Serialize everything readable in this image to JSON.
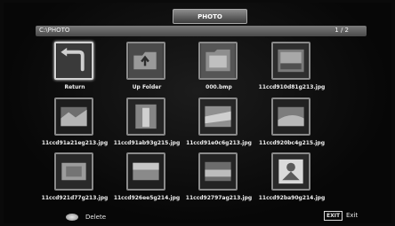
{
  "header": {
    "title": "PHOTO"
  },
  "path_bar": {
    "path": "C:\\PHOTO",
    "page": "1 / 2"
  },
  "grid": {
    "items": [
      {
        "label": "Return",
        "icon": "return-icon",
        "kind": "nav"
      },
      {
        "label": "Up Folder",
        "icon": "up-folder-icon",
        "kind": "nav"
      },
      {
        "label": "000.bmp",
        "icon": "image-thumbnail",
        "kind": "file"
      },
      {
        "label": "11ccd910d81g213.jpg",
        "icon": "image-thumbnail",
        "kind": "file"
      },
      {
        "label": "11ccd91a21eg213.jpg",
        "icon": "image-thumbnail",
        "kind": "file"
      },
      {
        "label": "11ccd91ab93g215.jpg",
        "icon": "image-thumbnail",
        "kind": "file"
      },
      {
        "label": "11ccd91e0c6g213.jpg",
        "icon": "image-thumbnail",
        "kind": "file"
      },
      {
        "label": "11ccd920bc4g215.jpg",
        "icon": "image-thumbnail",
        "kind": "file"
      },
      {
        "label": "11ccd921d77g213.jpg",
        "icon": "image-thumbnail",
        "kind": "file"
      },
      {
        "label": "11ccd926ee5g214.jpg",
        "icon": "image-thumbnail",
        "kind": "file"
      },
      {
        "label": "11ccd92797ag213.jpg",
        "icon": "image-thumbnail",
        "kind": "file"
      },
      {
        "label": "11ccd92ba90g214.jpg",
        "icon": "image-thumbnail",
        "kind": "file"
      }
    ]
  },
  "footer": {
    "delete_label": "Delete",
    "exit_key": "EXIT",
    "exit_label": "Exit"
  }
}
